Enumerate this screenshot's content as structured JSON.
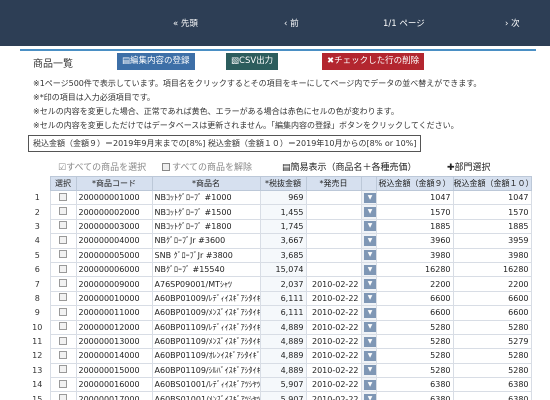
{
  "nav": {
    "first": "« 先頭",
    "prev": "‹ 前",
    "page": "1/1 ページ",
    "next": "› 次"
  },
  "header": {
    "title": "商品一覧",
    "save_button": "編集内容の登録",
    "csv_button": "CSV出力",
    "delete_button": "チェックした行の削除"
  },
  "notices": [
    "※1ページ500件で表示しています。項目名をクリックするとその項目をキーにしてページ内でデータの並べ替えができます。",
    "※*印の項目は入力必須項目です。",
    "※セルの内容を変更した場合、正常であれば黄色、エラーがある場合は赤色にセルの色が変わります。",
    "※セルの内容を変更しただけではデータベースは更新されません。「編集内容の登録」ボタンをクリックしてください。"
  ],
  "tax_note": "税込金額（金額９）＝2019年9月末までの[8%] 税込金額（金額１０）＝2019年10月からの[8% or 10%]",
  "controls": {
    "select_all": "すべての商品を選択",
    "clear_all": "すべての商品を解除",
    "simple_view": "簡易表示（商品名＋各種売価）",
    "dept_select": "✚部門選択"
  },
  "table": {
    "headers": [
      "選択",
      "*商品コード",
      "*商品名",
      "*税抜金額",
      "*発売日",
      "",
      "税込金額（金額９）",
      "税込金額（金額１０）"
    ],
    "rows": [
      {
        "no": "1",
        "code": "200000001000",
        "name": "NBｺｯﾄｸﾞﾛｰﾌﾞ #1000",
        "price": "969",
        "date": "",
        "tax9": "1047",
        "tax10": "1047"
      },
      {
        "no": "2",
        "code": "200000002000",
        "name": "NBｺｯﾄｸﾞﾛｰﾌﾞ #1500",
        "price": "1,455",
        "date": "",
        "tax9": "1570",
        "tax10": "1570"
      },
      {
        "no": "3",
        "code": "200000003000",
        "name": "NBｺｯﾄｸﾞﾛｰﾌﾞ #1800",
        "price": "1,745",
        "date": "",
        "tax9": "1885",
        "tax10": "1885"
      },
      {
        "no": "4",
        "code": "200000004000",
        "name": "NBｸﾞﾛｰﾌﾞJr #3600",
        "price": "3,667",
        "date": "",
        "tax9": "3960",
        "tax10": "3959"
      },
      {
        "no": "5",
        "code": "200000005000",
        "name": "SNB ｸﾞﾛｰﾌﾞJr #3800",
        "price": "3,685",
        "date": "",
        "tax9": "3980",
        "tax10": "3980"
      },
      {
        "no": "6",
        "code": "200000006000",
        "name": "NBｸﾞﾛｰﾌﾞ #15540",
        "price": "15,074",
        "date": "",
        "tax9": "16280",
        "tax10": "16280"
      },
      {
        "no": "7",
        "code": "200000009000",
        "name": "A76SP09001/MTｼｬﾂ",
        "price": "2,037",
        "date": "2010-02-22",
        "tax9": "2200",
        "tax10": "2200"
      },
      {
        "no": "8",
        "code": "200000010000",
        "name": "A60BP01009/ﾚﾃﾞｨｲｽｷﾞｱｼﾀｲｷﾞ",
        "price": "6,111",
        "date": "2010-02-22",
        "tax9": "6600",
        "tax10": "6600"
      },
      {
        "no": "9",
        "code": "200000011000",
        "name": "A60BP01009/ﾒﾝｽﾞｲｽｷﾞｱｼﾀｲｷﾞ",
        "price": "6,111",
        "date": "2010-02-22",
        "tax9": "6600",
        "tax10": "6600"
      },
      {
        "no": "10",
        "code": "200000012000",
        "name": "A60BP01109/ﾚﾃﾞｨｲｽｷﾞｱｼﾀｲｷﾞ",
        "price": "4,889",
        "date": "2010-02-22",
        "tax9": "5280",
        "tax10": "5280"
      },
      {
        "no": "11",
        "code": "200000013000",
        "name": "A60BP01109/ﾒﾝｽﾞｲｽｷﾞｱｼﾀｲｷﾞ",
        "price": "4,889",
        "date": "2010-02-22",
        "tax9": "5280",
        "tax10": "5279"
      },
      {
        "no": "12",
        "code": "200000014000",
        "name": "A60BP01109/ｵﾚﾝｲｽｷﾞｱｼﾀｲｷﾞ",
        "price": "4,889",
        "date": "2010-02-22",
        "tax9": "5280",
        "tax10": "5280"
      },
      {
        "no": "13",
        "code": "200000015000",
        "name": "A60BP01109/ｼﾙﾊﾞｲｽｷﾞｱｼﾀｲｷﾞ",
        "price": "4,889",
        "date": "2010-02-22",
        "tax9": "5280",
        "tax10": "5280"
      },
      {
        "no": "14",
        "code": "200000016000",
        "name": "A60BS01001/ﾚﾃﾞｨｲｽｷﾞｱﾂｼﾔﾂ",
        "price": "5,907",
        "date": "2010-02-22",
        "tax9": "6380",
        "tax10": "6380"
      },
      {
        "no": "15",
        "code": "200000017000",
        "name": "A60BS01001/ﾒﾝｽﾞｲｽｷﾞｱﾂｼﾔﾂ",
        "price": "5,907",
        "date": "2010-02-22",
        "tax9": "6380",
        "tax10": "6380"
      }
    ]
  }
}
